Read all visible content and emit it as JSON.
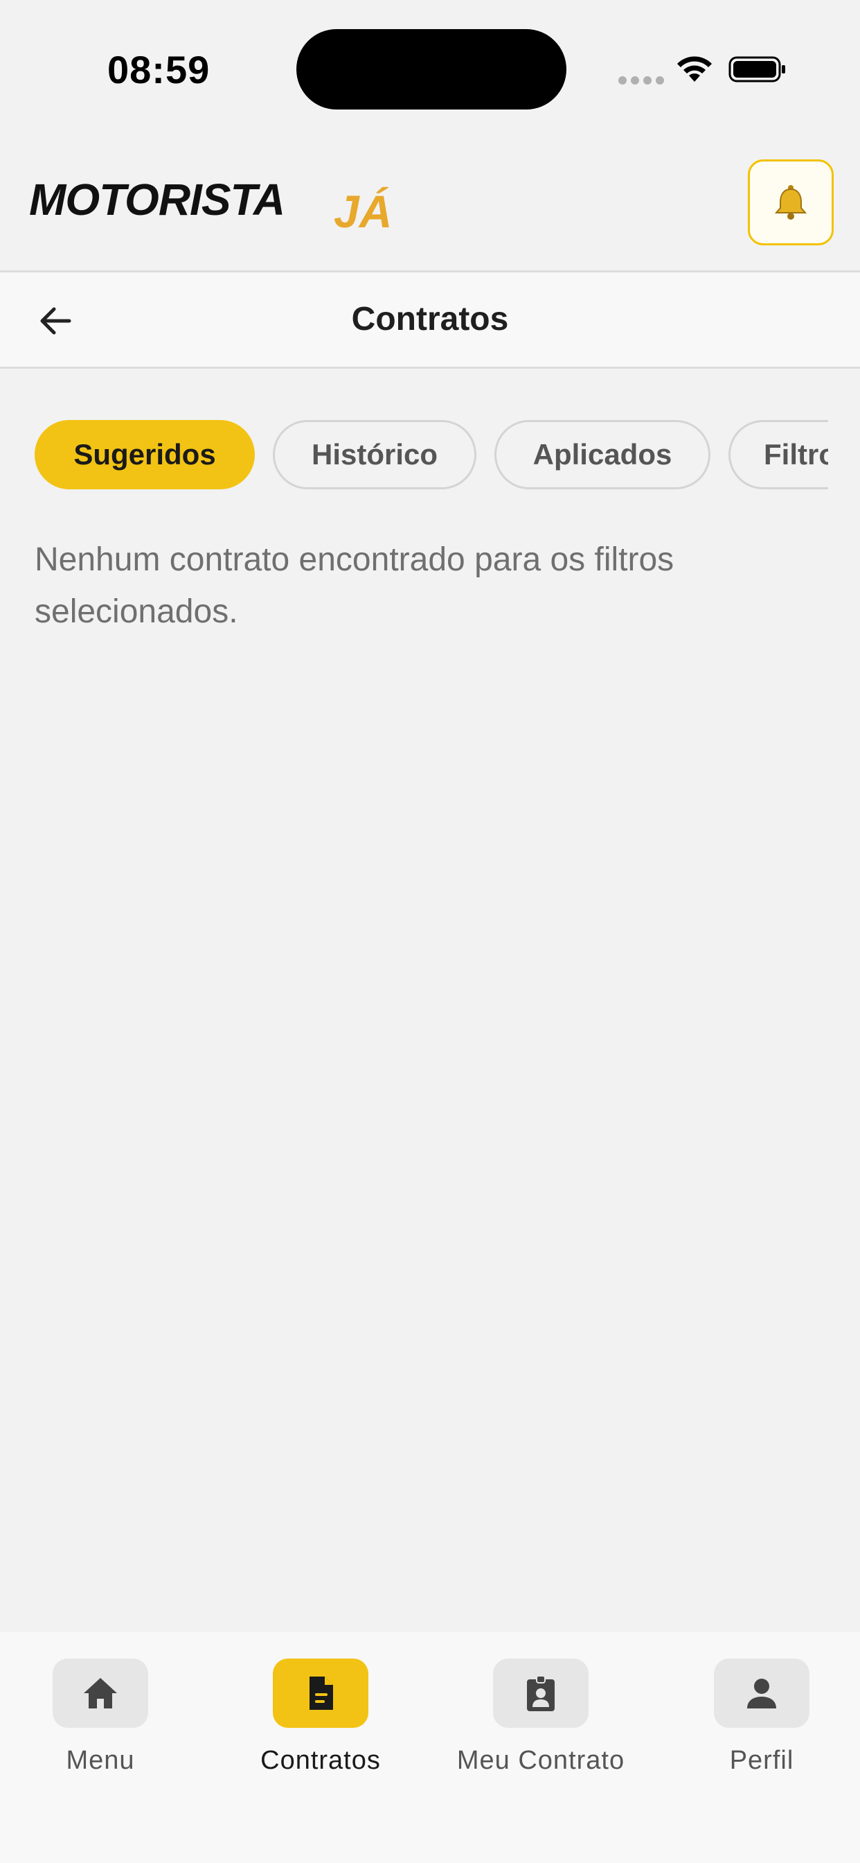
{
  "status_bar": {
    "time": "08:59"
  },
  "header": {
    "logo_main": "MOTORISTA",
    "logo_accent": "JÁ",
    "logo_accent_color": "#e8a82c",
    "bell_icon": "bell-icon"
  },
  "title_bar": {
    "title": "Contratos",
    "back_icon": "arrow-left-icon"
  },
  "filters": {
    "chips": [
      {
        "label": "Sugeridos",
        "selected": true
      },
      {
        "label": "Histórico",
        "selected": false
      },
      {
        "label": "Aplicados",
        "selected": false
      },
      {
        "label": "Filtro",
        "selected": false
      }
    ]
  },
  "empty_message": "Nenhum contrato encontrado para os filtros selecionados.",
  "bottom_nav": {
    "items": [
      {
        "label": "Menu",
        "icon": "home-icon",
        "active": false
      },
      {
        "label": "Contratos",
        "icon": "document-icon",
        "active": true
      },
      {
        "label": "Meu Contrato",
        "icon": "badge-icon",
        "active": false
      },
      {
        "label": "Perfil",
        "icon": "person-icon",
        "active": false
      }
    ]
  },
  "colors": {
    "accent": "#f2c314",
    "background": "#f2f2f2"
  }
}
